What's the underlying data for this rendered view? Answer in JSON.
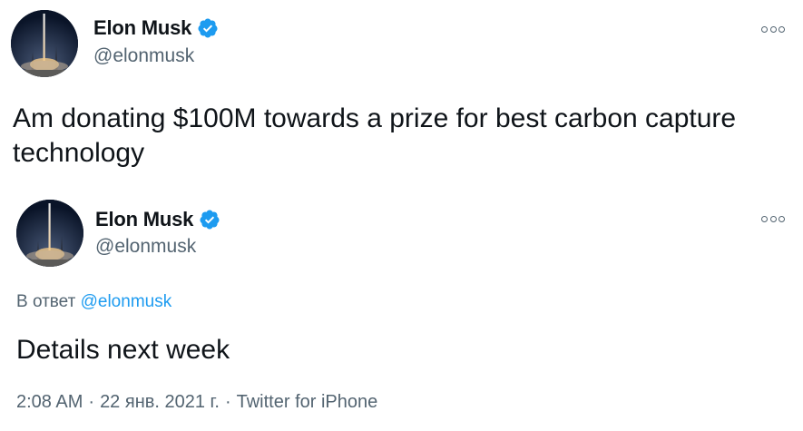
{
  "tweet1": {
    "author": {
      "display_name": "Elon Musk",
      "handle": "@elonmusk",
      "verified": true,
      "avatar_icon": "rocket-launch-avatar"
    },
    "more_icon": "more-options-icon",
    "text": "Am donating $100M towards a prize for best carbon capture technology"
  },
  "tweet2": {
    "author": {
      "display_name": "Elon Musk",
      "handle": "@elonmusk",
      "verified": true,
      "avatar_icon": "rocket-launch-avatar"
    },
    "more_icon": "more-options-icon",
    "reply_prefix": "В ответ",
    "reply_handle": "@elonmusk",
    "text": "Details next week",
    "meta": {
      "time": "2:08 AM",
      "sep1": "·",
      "date": "22 янв. 2021 г.",
      "sep2": "·",
      "source": "Twitter for iPhone"
    }
  },
  "colors": {
    "text": "#0f1419",
    "secondary": "#536471",
    "link": "#1d9bf0",
    "verified": "#1d9bf0"
  }
}
